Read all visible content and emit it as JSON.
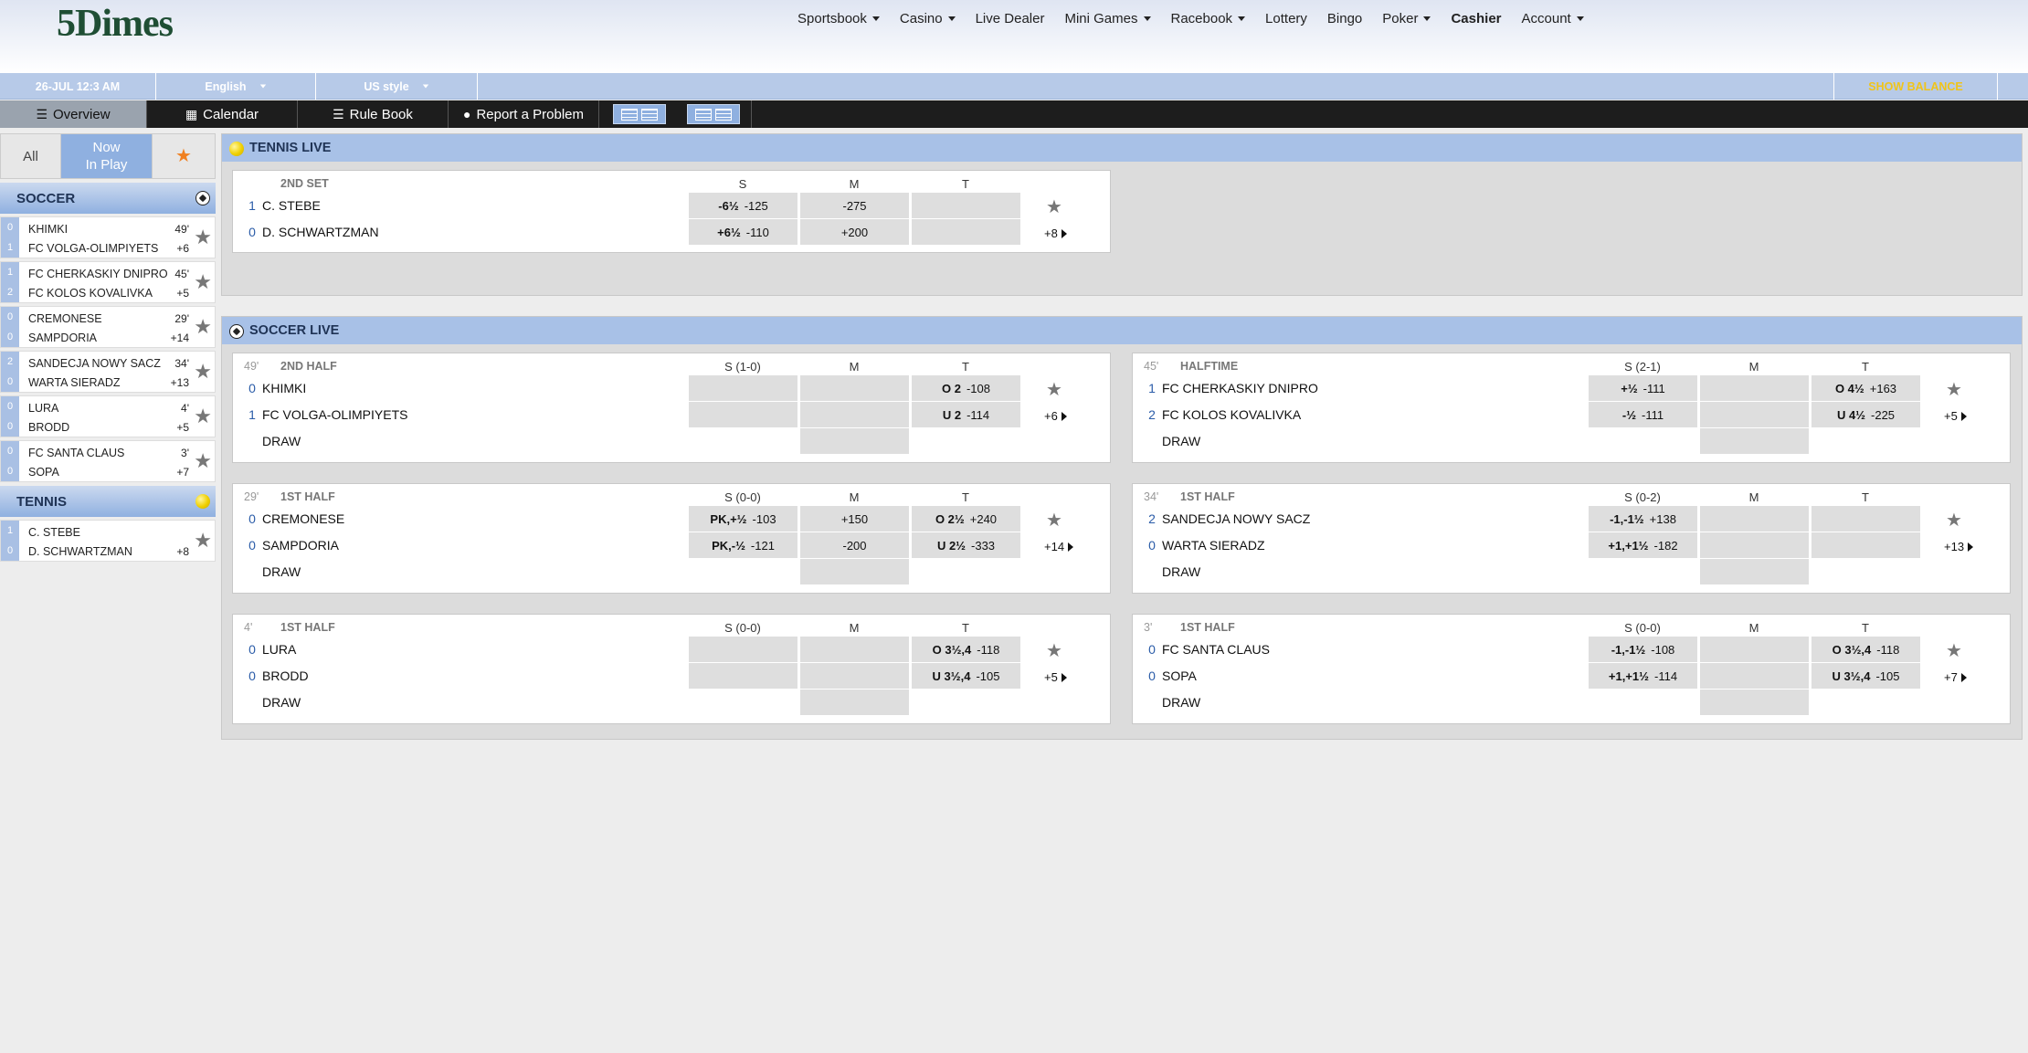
{
  "header": {
    "logo": "5Dimes",
    "nav": [
      {
        "label": "Sportsbook",
        "dropdown": true
      },
      {
        "label": "Casino",
        "dropdown": true
      },
      {
        "label": "Live Dealer",
        "dropdown": false
      },
      {
        "label": "Mini Games",
        "dropdown": true
      },
      {
        "label": "Racebook",
        "dropdown": true
      },
      {
        "label": "Lottery",
        "dropdown": false
      },
      {
        "label": "Bingo",
        "dropdown": false
      },
      {
        "label": "Poker",
        "dropdown": true
      },
      {
        "label": "Cashier",
        "dropdown": false,
        "bold": true
      },
      {
        "label": "Account",
        "dropdown": true
      }
    ]
  },
  "infobar": {
    "datetime": "26-JUL 12:3 AM",
    "language": "English",
    "odds_style": "US style",
    "balance_label": "SHOW BALANCE"
  },
  "toolbar": {
    "overview": "Overview",
    "calendar": "Calendar",
    "rulebook": "Rule Book",
    "report": "Report a Problem"
  },
  "left_panel": {
    "tabs": {
      "all": "All",
      "now_line1": "Now",
      "now_line2": "In Play",
      "fav_icon": "star-icon"
    },
    "soccer_title": "SOCCER",
    "tennis_title": "TENNIS",
    "soccer_games": [
      {
        "s1": "0",
        "s2": "1",
        "t1": "KHIMKI",
        "t2": "FC VOLGA-OLIMPIYETS",
        "min": "49'",
        "more": "+6"
      },
      {
        "s1": "1",
        "s2": "2",
        "t1": "FC CHERKASKIY DNIPRO",
        "t2": "FC KOLOS KOVALIVKA",
        "min": "45'",
        "more": "+5"
      },
      {
        "s1": "0",
        "s2": "0",
        "t1": "CREMONESE",
        "t2": "SAMPDORIA",
        "min": "29'",
        "more": "+14"
      },
      {
        "s1": "2",
        "s2": "0",
        "t1": "SANDECJA NOWY SACZ",
        "t2": "WARTA SIERADZ",
        "min": "34'",
        "more": "+13"
      },
      {
        "s1": "0",
        "s2": "0",
        "t1": "LURA",
        "t2": "BRODD",
        "min": "4'",
        "more": "+5"
      },
      {
        "s1": "0",
        "s2": "0",
        "t1": "FC SANTA CLAUS",
        "t2": "SOPA",
        "min": "3'",
        "more": "+7"
      }
    ],
    "tennis_games": [
      {
        "s1": "1",
        "s2": "0",
        "t1": "C. STEBE",
        "t2": "D. SCHWARTZMAN",
        "min": "",
        "more": "+8"
      }
    ]
  },
  "tennis_live": {
    "title": "TENNIS LIVE",
    "card": {
      "min": "",
      "period": "2ND SET",
      "col_s": "S",
      "col_m": "M",
      "col_t": "T",
      "rows": [
        {
          "score": "1",
          "team": "C. STEBE",
          "s": [
            "-6½",
            "-125"
          ],
          "m": "-275",
          "t": [
            "",
            ""
          ]
        },
        {
          "score": "0",
          "team": "D. SCHWARTZMAN",
          "s": [
            "+6½",
            "-110"
          ],
          "m": "+200",
          "t": [
            "",
            ""
          ]
        }
      ],
      "more": "+8"
    }
  },
  "soccer_live": {
    "title": "SOCCER LIVE",
    "draw_label": "DRAW",
    "cards": [
      {
        "min": "49'",
        "period": "2ND HALF",
        "col_s": "S (1-0)",
        "col_m": "M",
        "col_t": "T",
        "rows": [
          {
            "score": "0",
            "team": "KHIMKI",
            "s": [
              "",
              ""
            ],
            "m": "",
            "t": [
              "O 2",
              "-108"
            ]
          },
          {
            "score": "1",
            "team": "FC VOLGA-OLIMPIYETS",
            "s": [
              "",
              ""
            ],
            "m": "",
            "t": [
              "U 2",
              "-114"
            ]
          }
        ],
        "draw_m": "",
        "more": "+6"
      },
      {
        "min": "45'",
        "period": "HALFTIME",
        "col_s": "S (2-1)",
        "col_m": "M",
        "col_t": "T",
        "rows": [
          {
            "score": "1",
            "team": "FC CHERKASKIY DNIPRO",
            "s": [
              "+½",
              "-111"
            ],
            "m": "",
            "t": [
              "O 4½",
              "+163"
            ]
          },
          {
            "score": "2",
            "team": "FC KOLOS KOVALIVKA",
            "s": [
              "-½",
              "-111"
            ],
            "m": "",
            "t": [
              "U 4½",
              "-225"
            ]
          }
        ],
        "draw_m": "",
        "more": "+5"
      },
      {
        "min": "29'",
        "period": "1ST HALF",
        "col_s": "S (0-0)",
        "col_m": "M",
        "col_t": "T",
        "rows": [
          {
            "score": "0",
            "team": "CREMONESE",
            "s": [
              "PK,+½",
              "-103"
            ],
            "m": "+150",
            "t": [
              "O 2½",
              "+240"
            ]
          },
          {
            "score": "0",
            "team": "SAMPDORIA",
            "s": [
              "PK,-½",
              "-121"
            ],
            "m": "-200",
            "t": [
              "U 2½",
              "-333"
            ]
          }
        ],
        "draw_m": "",
        "more": "+14"
      },
      {
        "min": "34'",
        "period": "1ST HALF",
        "col_s": "S (0-2)",
        "col_m": "M",
        "col_t": "T",
        "rows": [
          {
            "score": "2",
            "team": "SANDECJA NOWY SACZ",
            "s": [
              "-1,-1½",
              "+138"
            ],
            "m": "",
            "t": [
              "",
              ""
            ]
          },
          {
            "score": "0",
            "team": "WARTA SIERADZ",
            "s": [
              "+1,+1½",
              "-182"
            ],
            "m": "",
            "t": [
              "",
              ""
            ]
          }
        ],
        "draw_m": "",
        "more": "+13"
      },
      {
        "min": "4'",
        "period": "1ST HALF",
        "col_s": "S (0-0)",
        "col_m": "M",
        "col_t": "T",
        "rows": [
          {
            "score": "0",
            "team": "LURA",
            "s": [
              "",
              ""
            ],
            "m": "",
            "t": [
              "O 3½,4",
              "-118"
            ]
          },
          {
            "score": "0",
            "team": "BRODD",
            "s": [
              "",
              ""
            ],
            "m": "",
            "t": [
              "U 3½,4",
              "-105"
            ]
          }
        ],
        "draw_m": "",
        "more": "+5"
      },
      {
        "min": "3'",
        "period": "1ST HALF",
        "col_s": "S (0-0)",
        "col_m": "M",
        "col_t": "T",
        "rows": [
          {
            "score": "0",
            "team": "FC SANTA CLAUS",
            "s": [
              "-1,-1½",
              "-108"
            ],
            "m": "",
            "t": [
              "O 3½,4",
              "-118"
            ]
          },
          {
            "score": "0",
            "team": "SOPA",
            "s": [
              "+1,+1½",
              "-114"
            ],
            "m": "",
            "t": [
              "U 3½,4",
              "-105"
            ]
          }
        ],
        "draw_m": "",
        "more": "+7"
      }
    ]
  }
}
